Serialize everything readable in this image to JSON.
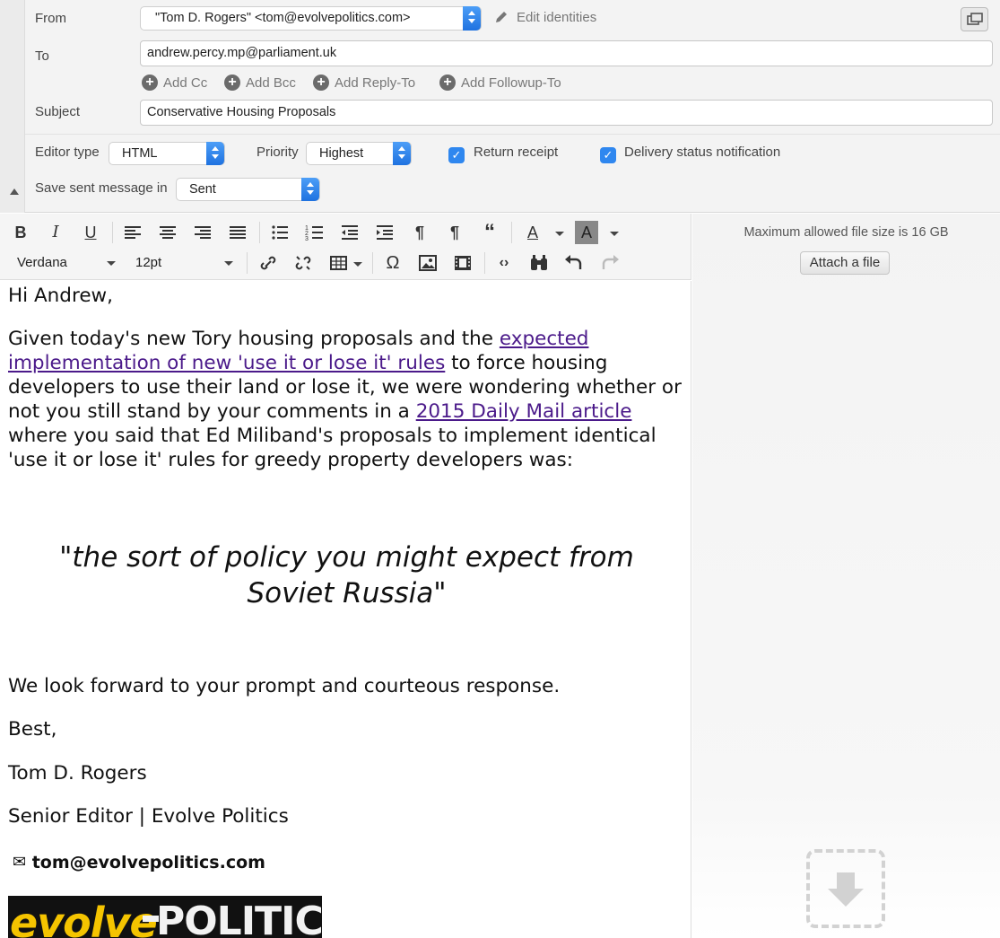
{
  "header": {
    "from_label": "From",
    "from_value": "\"Tom D. Rogers\" <tom@evolvepolitics.com>",
    "edit_identities": "Edit identities",
    "to_label": "To",
    "to_value": "andrew.percy.mp@parliament.uk",
    "add_links": [
      "Add Cc",
      "Add Bcc",
      "Add Reply-To",
      "Add Followup-To"
    ],
    "subject_label": "Subject",
    "subject_value": "Conservative Housing Proposals",
    "editor_type_label": "Editor type",
    "editor_type_value": "HTML",
    "priority_label": "Priority",
    "priority_value": "Highest",
    "return_receipt": "Return receipt",
    "return_receipt_checked": true,
    "delivery_status": "Delivery status notification",
    "delivery_status_checked": true,
    "save_sent_label": "Save sent message in",
    "save_sent_value": "Sent"
  },
  "toolbar": {
    "font_family": "Verdana",
    "font_size": "12pt",
    "icons": [
      "bold-icon",
      "italic-icon",
      "underline-icon",
      "align-left-icon",
      "align-center-icon",
      "align-right-icon",
      "align-justify-icon",
      "bullet-list-icon",
      "numbered-list-icon",
      "outdent-icon",
      "indent-icon",
      "ltr-icon",
      "rtl-icon",
      "blockquote-icon",
      "text-color-icon",
      "background-color-icon",
      "link-icon",
      "unlink-icon",
      "table-icon",
      "special-char-icon",
      "image-icon",
      "media-icon",
      "source-code-icon",
      "find-replace-icon",
      "undo-icon",
      "redo-icon"
    ]
  },
  "body": {
    "greeting": "Hi Andrew,",
    "para1_a": "Given today's new Tory housing proposals and the ",
    "para1_link1": "expected implementation of new 'use it or lose it' rules",
    "para1_b": " to force housing developers to use their land or lose it, we were wondering whether or not you still stand by your comments in a ",
    "para1_link2": "2015 Daily Mail article",
    "para1_c": " where you said that Ed Miliband's proposals to implement identical 'use it or lose it' rules for greedy property developers was:",
    "quote": "\"the sort of policy you might expect from Soviet Russia\"",
    "closing": "We look forward to your prompt and courteous response.",
    "signoff": "Best,",
    "sig_name": "Tom D. Rogers",
    "sig_title": "Senior Editor | Evolve Politics",
    "sig_email": "tom@evolvepolitics.com",
    "logo_part1": "evolve",
    "logo_part2": "POLITICS"
  },
  "attachments": {
    "max_size": "Maximum allowed file size is 16 GB",
    "attach_button": "Attach a file"
  },
  "colors": {
    "accent": "#2f87ef",
    "link": "#4b1a8a",
    "logo_yellow": "#f5c400"
  }
}
